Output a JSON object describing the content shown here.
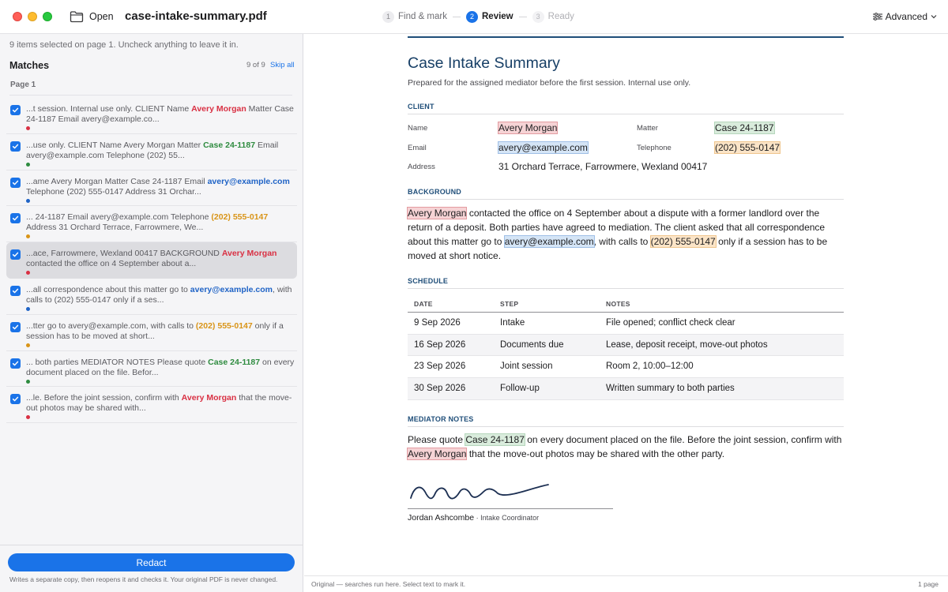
{
  "titlebar": {
    "open_label": "Open",
    "file_name": "case-intake-summary.pdf",
    "steps": [
      {
        "num": "1",
        "label": "Find & mark"
      },
      {
        "num": "2",
        "label": "Review"
      },
      {
        "num": "3",
        "label": "Ready"
      }
    ],
    "active_step": 2,
    "advanced_label": "Advanced"
  },
  "sidebar": {
    "selection_note": "9 items selected on page 1. Uncheck anything to leave it in.",
    "matches_title": "Matches",
    "count": "9 of 9",
    "skip_all": "Skip all",
    "page_label": "Page 1",
    "matches": [
      {
        "before": "...t session. Internal use only. CLIENT Name ",
        "hit": "Avery Morgan",
        "after": " Matter Case 24-1187 Email avery@example.co...",
        "color": "#d93043",
        "checked": true
      },
      {
        "before": "...use only. CLIENT Name Avery Morgan Matter ",
        "hit": "Case 24-1187",
        "after": " Email avery@example.com Telephone (202) 55...",
        "color": "#2e8b3f",
        "checked": true
      },
      {
        "before": "...ame Avery Morgan Matter Case 24-1187 Email ",
        "hit": "avery@example.com",
        "after": " Telephone (202) 555-0147 Address 31 Orchar...",
        "color": "#1f63c6",
        "checked": true
      },
      {
        "before": "... 24-1187 Email avery@example.com Telephone ",
        "hit": "(202) 555-0147",
        "after": " Address 31 Orchard Terrace, Farrowmere, We...",
        "color": "#d99417",
        "checked": true
      },
      {
        "before": "...ace, Farrowmere, Wexland 00417 BACKGROUND ",
        "hit": "Avery Morgan",
        "after": " contacted the office on 4 September about a...",
        "color": "#d93043",
        "checked": true,
        "selected": true
      },
      {
        "before": "...all correspondence about this matter go to ",
        "hit": "avery@example.com",
        "after": ", with calls to (202) 555-0147 only if a ses...",
        "color": "#1f63c6",
        "checked": true
      },
      {
        "before": "...tter go to avery@example.com, with calls to ",
        "hit": "(202) 555-0147",
        "after": " only if a session has to be moved at short...",
        "color": "#d99417",
        "checked": true
      },
      {
        "before": "... both parties MEDIATOR NOTES Please quote ",
        "hit": "Case 24-1187",
        "after": " on every document placed on the file. Befor...",
        "color": "#2e8b3f",
        "checked": true
      },
      {
        "before": "...le. Before the joint session, confirm with ",
        "hit": "Avery Morgan",
        "after": " that the move-out photos may be shared with...",
        "color": "#d93043",
        "checked": true
      }
    ],
    "redact_label": "Redact",
    "footer_note": "Writes a separate copy, then reopens it and checks it. Your original PDF is never changed."
  },
  "document": {
    "title": "Case Intake Summary",
    "subtitle": "Prepared for the assigned mediator before the first session. Internal use only.",
    "client_heading": "CLIENT",
    "client": {
      "name_label": "Name",
      "name_value": "Avery Morgan",
      "matter_label": "Matter",
      "matter_value": "Case 24-1187",
      "email_label": "Email",
      "email_value": "avery@example.com",
      "telephone_label": "Telephone",
      "telephone_value": "(202) 555-0147",
      "address_label": "Address",
      "address_value": "31 Orchard Terrace, Farrowmere, Wexland 00417"
    },
    "background_heading": "BACKGROUND",
    "background": {
      "name": "Avery Morgan",
      "text1": " contacted the office on 4 September about a dispute with a former landlord over the return of a deposit. Both parties have agreed to mediation. The client asked that all correspondence about this matter go to ",
      "email": "avery@example.com",
      "text2": ", with calls to ",
      "phone": "(202) 555-0147",
      "text3": " only if a session has to be moved at short notice."
    },
    "schedule_heading": "SCHEDULE",
    "schedule": {
      "headers": [
        "DATE",
        "STEP",
        "NOTES"
      ],
      "rows": [
        [
          "9 Sep 2026",
          "Intake",
          "File opened; conflict check clear"
        ],
        [
          "16 Sep 2026",
          "Documents due",
          "Lease, deposit receipt, move-out photos"
        ],
        [
          "23 Sep 2026",
          "Joint session",
          "Room 2, 10:00–12:00"
        ],
        [
          "30 Sep 2026",
          "Follow-up",
          "Written summary to both parties"
        ]
      ]
    },
    "notes_heading": "MEDIATOR NOTES",
    "notes": {
      "text1": "Please quote ",
      "case": "Case 24-1187",
      "text2": " on every document placed on the file. Before the joint session, confirm with ",
      "name": "Avery Morgan",
      "text3": " that the move-out photos may be shared with the other party."
    },
    "signer_name": "Jordan Ashcombe",
    "signer_sep": " · ",
    "signer_role": "Intake Coordinator"
  },
  "status": {
    "left": "Original — searches run here. Select text to mark it.",
    "right": "1 page"
  },
  "colors": {
    "accent": "#1a73e8",
    "name_hit": "#d93043",
    "case_hit": "#2e8b3f",
    "email_hit": "#1f63c6",
    "phone_hit": "#d99417"
  }
}
